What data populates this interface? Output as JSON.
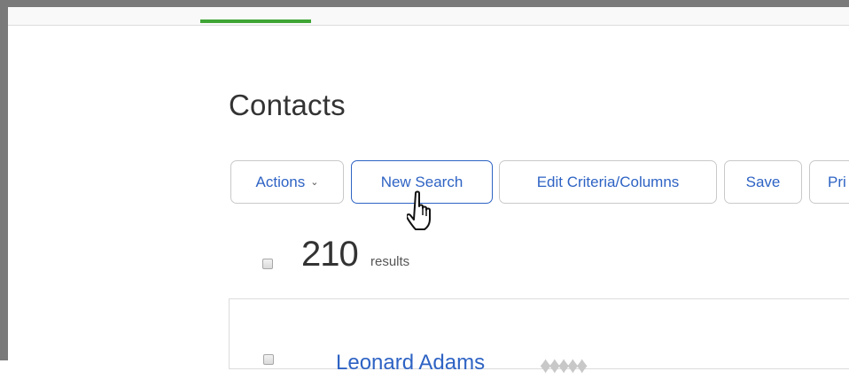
{
  "header": {
    "active_tab_color": "#3fa535"
  },
  "page": {
    "title": "Contacts"
  },
  "toolbar": {
    "buttons": [
      {
        "label": "Actions",
        "icon": "chevron-down-icon"
      },
      {
        "label": "New Search",
        "state": "hover"
      },
      {
        "label": "Edit Criteria/Columns"
      },
      {
        "label": "Save"
      },
      {
        "label": "Pri"
      }
    ]
  },
  "results": {
    "count": "210",
    "label": "results"
  },
  "list": {
    "rows": [
      {
        "name": "Leonard Adams",
        "rating_icon": "drop-rating-icon",
        "rating_glyphs": "♦♦♦♦♦"
      }
    ]
  },
  "colors": {
    "link": "#2e63c4",
    "border": "#c9c9c9",
    "frame": "#7a7a7a"
  }
}
